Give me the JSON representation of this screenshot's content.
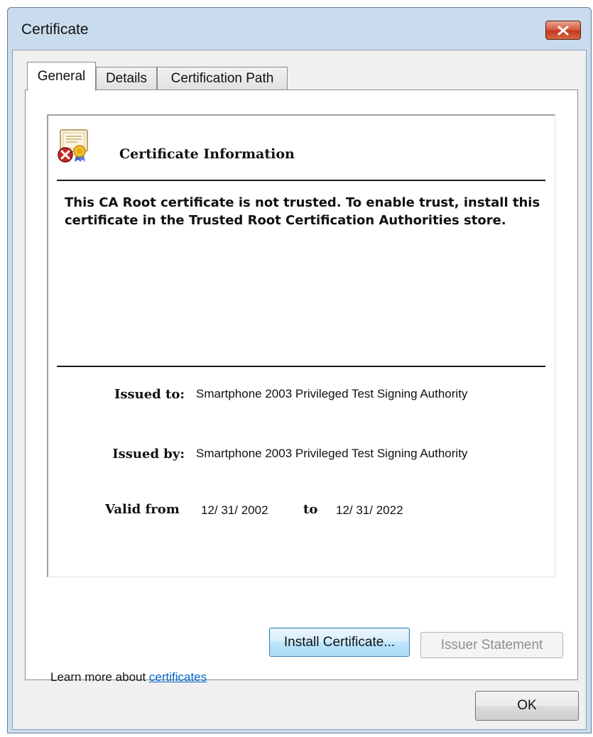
{
  "window": {
    "title": "Certificate"
  },
  "tabs": [
    {
      "label": "General",
      "selected": true
    },
    {
      "label": "Details",
      "selected": false
    },
    {
      "label": "Certification Path",
      "selected": false
    }
  ],
  "info": {
    "icon": "certificate-error-icon",
    "title": "Certificate Information",
    "warning": "This CA Root certificate is not trusted. To enable trust, install this certificate in the Trusted Root Certification Authorities store."
  },
  "fields": {
    "issued_to_label": "Issued to:",
    "issued_to_value": "Smartphone 2003 Privileged Test Signing Authority",
    "issued_by_label": "Issued by:",
    "issued_by_value": "Smartphone 2003 Privileged Test Signing Authority",
    "valid_from_label": "Valid from",
    "valid_from_value": "12/ 31/ 2002",
    "valid_to_label": "to",
    "valid_to_value": "12/ 31/ 2022"
  },
  "buttons": {
    "install": "Install Certificate...",
    "issuer_statement": "Issuer Statement",
    "ok": "OK"
  },
  "learn_more": {
    "prefix": "Learn more about ",
    "link": "certificates"
  },
  "colors": {
    "link": "#0066cc",
    "close_button": "#c23b1e",
    "disabled_text": "#8f8f8f"
  }
}
